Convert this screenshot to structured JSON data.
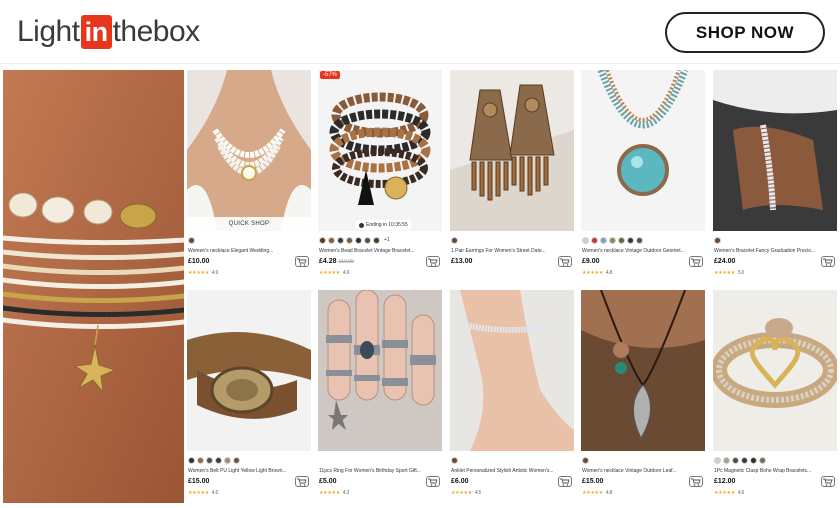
{
  "header": {
    "logo": {
      "left": "Light",
      "middle": "in",
      "right": "thebox"
    },
    "cta": "SHOP NOW"
  },
  "colors": {
    "brand": "#e8361d",
    "star": "#f5a623",
    "text": "#333333"
  },
  "hero": {
    "alt_icon": "anklet-photo"
  },
  "products": [
    {
      "id": "p1",
      "title": "Women's necklace Elegant Wedding...",
      "price": "£10.00",
      "old": "",
      "rating": "4.9",
      "quick": "QUICK SHOP",
      "sale": "",
      "ending": "",
      "more": "",
      "swatches": [
        "#6b4a2f"
      ],
      "icon": "pearl-necklace-image"
    },
    {
      "id": "p2",
      "title": "Women's Bead Bracelet Vintage Bracelet...",
      "price": "£4.28",
      "old": "£10.00",
      "rating": "4.9",
      "quick": "",
      "sale": "-57%",
      "ending": "Ending in 10:35:55",
      "more": "+1",
      "swatches": [
        "#5b3a26",
        "#8a5b3a",
        "#3a3a3a",
        "#7b5a3a",
        "#2f2f2f",
        "#6a4a2a",
        "#4a3a2a"
      ],
      "icon": "bead-bracelet-image"
    },
    {
      "id": "p3",
      "title": "1 Pair Earrings For Women's Street Date...",
      "price": "£13.00",
      "old": "",
      "rating": "",
      "quick": "",
      "sale": "",
      "ending": "",
      "more": "",
      "swatches": [
        "#6b4a2f"
      ],
      "icon": "earrings-image"
    },
    {
      "id": "p4",
      "title": "Women's necklace Vintage Outdoor Geomet...",
      "price": "£9.00",
      "old": "",
      "rating": "4.8",
      "quick": "",
      "sale": "",
      "ending": "",
      "more": "",
      "swatches": [
        "#cfcfcf",
        "#c23a2a",
        "#7aa0c0",
        "#8a8a5a",
        "#5a6a3a",
        "#3a3a2a",
        "#6a4a3a"
      ],
      "icon": "turquoise-necklace-image"
    },
    {
      "id": "p5",
      "title": "Women's Bracelet Fancy Graduation Precio...",
      "price": "£24.00",
      "old": "",
      "rating": "5.0",
      "quick": "",
      "sale": "",
      "ending": "",
      "more": "",
      "swatches": [
        "#6b4a2f"
      ],
      "icon": "tennis-bracelet-image"
    },
    {
      "id": "p6",
      "title": "Women's Belt PU Light Yellow Light Brown...",
      "price": "£15.00",
      "old": "",
      "rating": "4.5",
      "quick": "",
      "sale": "",
      "ending": "",
      "more": "",
      "swatches": [
        "#2f2f2f",
        "#8a6a4a",
        "#5a4a3a",
        "#3a3a3a",
        "#a08a6a",
        "#6a5a3a"
      ],
      "icon": "belt-image"
    },
    {
      "id": "p7",
      "title": "11pcs Ring For Women's Birthday Sport Gift...",
      "price": "£5.00",
      "old": "",
      "rating": "4.3",
      "quick": "",
      "sale": "",
      "ending": "",
      "more": "",
      "swatches": [],
      "icon": "rings-image"
    },
    {
      "id": "p8",
      "title": "Anklet Personalized Stylish Artistic Women's...",
      "price": "£6.00",
      "old": "",
      "rating": "4.5",
      "quick": "",
      "sale": "",
      "ending": "",
      "more": "",
      "swatches": [
        "#6b4a2f"
      ],
      "icon": "anklet-image"
    },
    {
      "id": "p9",
      "title": "Women's necklace Vintage Outdoor Leaf...",
      "price": "£15.00",
      "old": "",
      "rating": "4.8",
      "quick": "",
      "sale": "",
      "ending": "",
      "more": "",
      "swatches": [
        "#6b4a2f"
      ],
      "icon": "leaf-necklace-image"
    },
    {
      "id": "p10",
      "title": "1Pc Magnetic Clasp Boho Wrap Bracelets...",
      "price": "£12.00",
      "old": "",
      "rating": "4.6",
      "quick": "",
      "sale": "",
      "ending": "",
      "more": "",
      "swatches": [
        "#cfcfcf",
        "#a0a0a0",
        "#5a4a3a",
        "#3a3a3a",
        "#2f2f2f",
        "#7a6a5a"
      ],
      "icon": "wrap-bracelet-image"
    }
  ]
}
